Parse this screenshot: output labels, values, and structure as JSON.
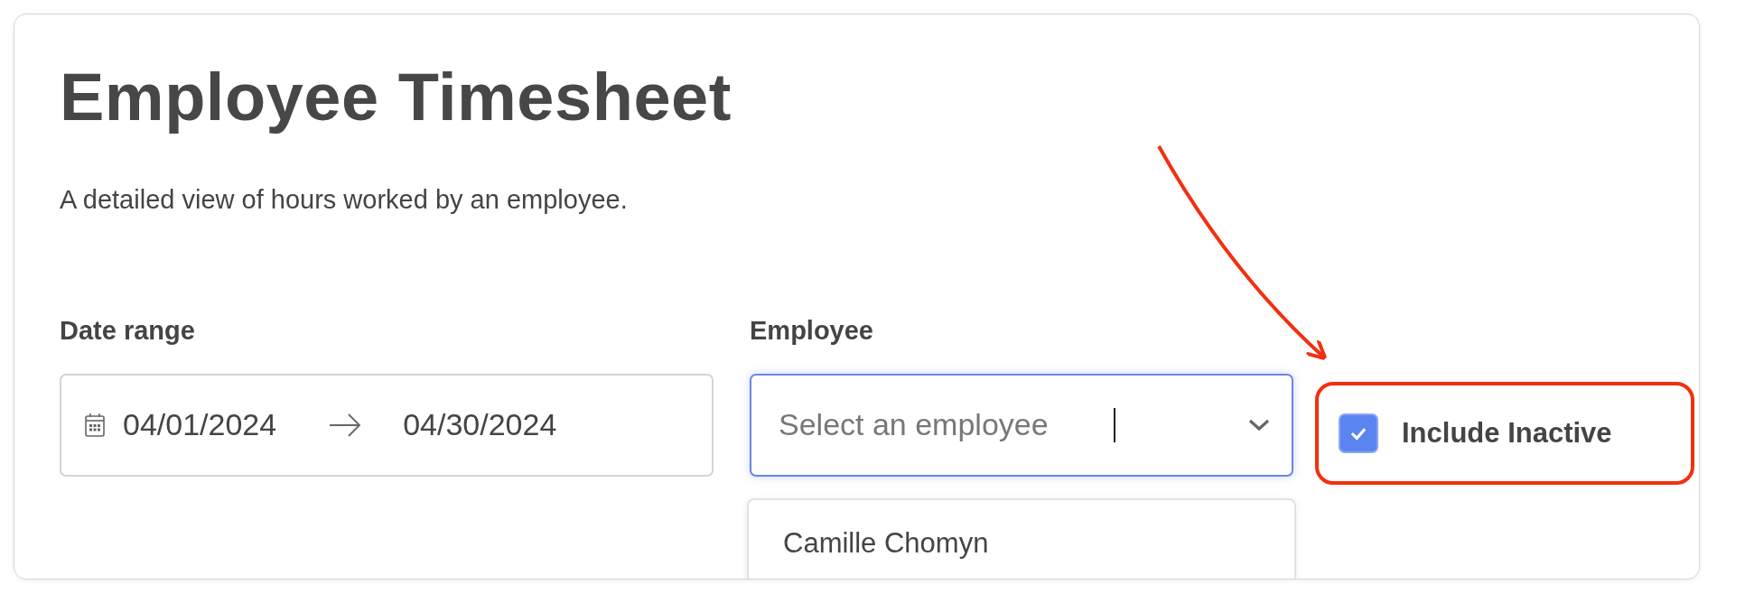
{
  "title": "Employee Timesheet",
  "subtitle": "A detailed view of hours worked by an employee.",
  "date_range": {
    "label": "Date range",
    "start": "04/01/2024",
    "end": "04/30/2024"
  },
  "employee": {
    "label": "Employee",
    "placeholder": "Select an employee",
    "focused": true,
    "options": [
      "Camille Chomyn"
    ]
  },
  "include_inactive": {
    "label": "Include Inactive",
    "checked": true
  }
}
